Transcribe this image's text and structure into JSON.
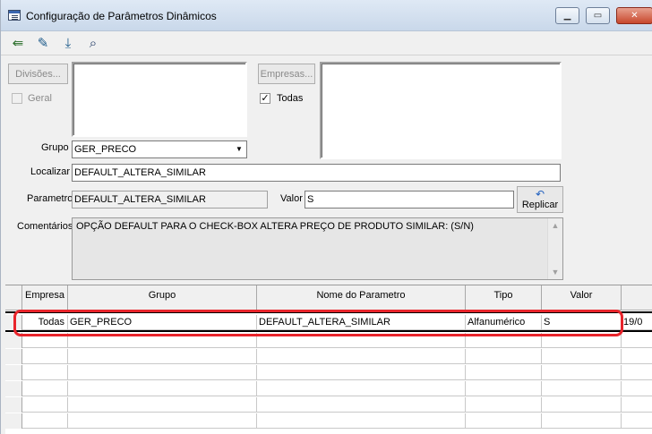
{
  "window": {
    "title": "Configuração de Parâmetros Dinâmicos",
    "controls": {
      "minimize": "▁",
      "maximize": "▭",
      "close": "✕"
    }
  },
  "toolbar": {
    "icons": [
      "exit-icon",
      "edit-icon",
      "save-icon",
      "find-icon"
    ],
    "glyphs": {
      "exit": "⇚",
      "edit": "✎",
      "save": "⤓",
      "find": "⌕"
    }
  },
  "form": {
    "divisoes_button": "Divisões...",
    "geral_label": "Geral",
    "geral_checked": false,
    "empresas_button": "Empresas...",
    "todas_label": "Todas",
    "todas_checked": true,
    "check_mark": "✓",
    "grupo_label": "Grupo",
    "grupo_value": "GER_PRECO",
    "combo_arrow": "▼",
    "localizar_label": "Localizar",
    "localizar_value": "DEFAULT_ALTERA_SIMILAR",
    "parametro_label": "Parametro",
    "parametro_value": "DEFAULT_ALTERA_SIMILAR",
    "valor_label": "Valor",
    "valor_value": "S",
    "replicar_button": "Replicar",
    "replicar_glyph": "↶",
    "comentarios_label": "Comentários",
    "comentarios_value": "OPÇÃO DEFAULT PARA O CHECK-BOX ALTERA PREÇO DE PRODUTO SIMILAR: (S/N)",
    "scroll_up": "▲",
    "scroll_down": "▼"
  },
  "grid": {
    "columns": [
      "Empresa",
      "Grupo",
      "Nome do Parametro",
      "Tipo",
      "Valor"
    ],
    "rows": [
      {
        "empresa": "Todas",
        "grupo": "GER_PRECO",
        "nome": "DEFAULT_ALTERA_SIMILAR",
        "tipo": "Alfanumérico",
        "valor": "S",
        "extra": "19/0"
      }
    ]
  },
  "colors": {
    "highlight": "#e8242b",
    "selection_bar": "#000000"
  }
}
